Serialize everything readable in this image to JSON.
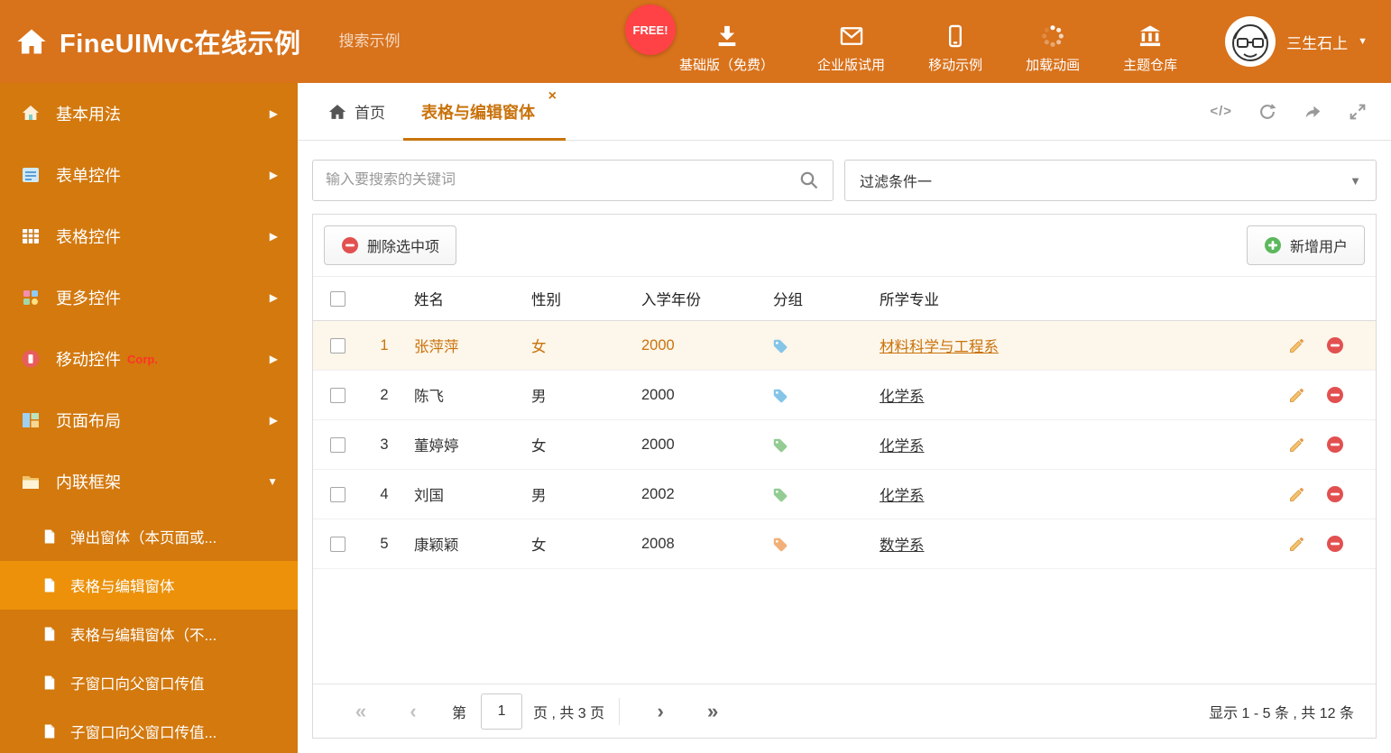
{
  "colors": {
    "topbar": "#D8721B",
    "sidebar": "#D3790E",
    "sidebar_selected": "#EC9109",
    "accent": "#C9730C",
    "free_badge": "#FF4245",
    "delete_red": "#E25050",
    "add_green": "#5CB85C",
    "row_selected_bg": "#FDF6EA"
  },
  "icons": {
    "caret_down": "▼",
    "arrow_right": "▶",
    "close": "×",
    "code": "</>",
    "page_first": "«",
    "page_prev": "‹",
    "page_next": "›",
    "page_last": "»"
  },
  "header": {
    "title": "FineUIMvc在线示例",
    "search_placeholder": "搜索示例",
    "free_badge": "FREE!",
    "nav": [
      {
        "label": "基础版（免费）"
      },
      {
        "label": "企业版试用"
      },
      {
        "label": "移动示例"
      },
      {
        "label": "加载动画"
      },
      {
        "label": "主题仓库"
      }
    ],
    "user_name": "三生石上"
  },
  "sidebar": {
    "items": [
      {
        "label": "基本用法"
      },
      {
        "label": "表单控件"
      },
      {
        "label": "表格控件"
      },
      {
        "label": "更多控件"
      },
      {
        "label": "移动控件",
        "badge": "Corp."
      },
      {
        "label": "页面布局"
      },
      {
        "label": "内联框架"
      }
    ],
    "subitems": [
      {
        "label": "弹出窗体（本页面或..."
      },
      {
        "label": "表格与编辑窗体"
      },
      {
        "label": "表格与编辑窗体（不..."
      },
      {
        "label": "子窗口向父窗口传值"
      },
      {
        "label": "子窗口向父窗口传值..."
      }
    ]
  },
  "tabs": {
    "home": "首页",
    "active": "表格与编辑窗体"
  },
  "filter": {
    "search_placeholder": "输入要搜索的关键词",
    "dropdown_value": "过滤条件一"
  },
  "toolbar": {
    "delete_label": "删除选中项",
    "add_label": "新增用户"
  },
  "table": {
    "columns": [
      "姓名",
      "性别",
      "入学年份",
      "分组",
      "所学专业"
    ],
    "rows": [
      {
        "num": "1",
        "name": "张萍萍",
        "gender": "女",
        "year": "2000",
        "tag_color": "#85C5E8",
        "major": "材料科学与工程系"
      },
      {
        "num": "2",
        "name": "陈飞",
        "gender": "男",
        "year": "2000",
        "tag_color": "#85C5E8",
        "major": "化学系"
      },
      {
        "num": "3",
        "name": "董婷婷",
        "gender": "女",
        "year": "2000",
        "tag_color": "#94CC94",
        "major": "化学系"
      },
      {
        "num": "4",
        "name": "刘国",
        "gender": "男",
        "year": "2002",
        "tag_color": "#94CC94",
        "major": "化学系"
      },
      {
        "num": "5",
        "name": "康颖颖",
        "gender": "女",
        "year": "2008",
        "tag_color": "#F2B078",
        "major": "数学系"
      }
    ]
  },
  "pagination": {
    "page_prefix": "第",
    "current_page": "1",
    "page_suffix": "页 , 共 3 页",
    "summary": "显示 1 - 5 条 , 共 12 条"
  }
}
